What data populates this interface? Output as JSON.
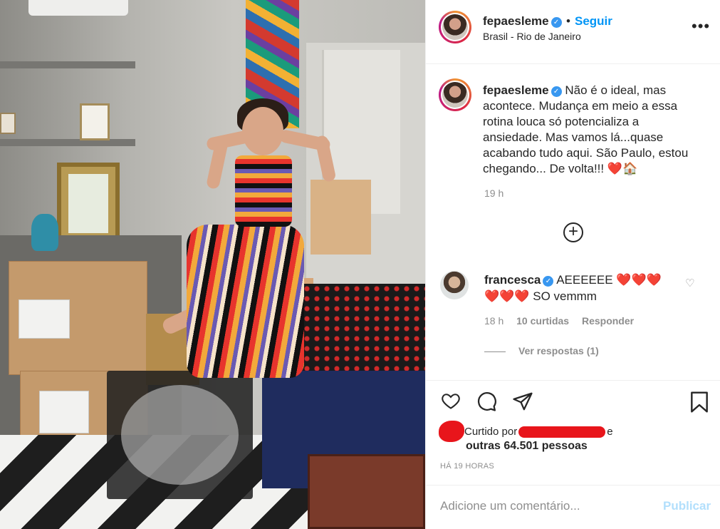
{
  "header": {
    "username": "fepaesleme",
    "separator": "•",
    "follow_label": "Seguir",
    "location": "Brasil - Rio de Janeiro",
    "more_icon": "more-horizontal-icon"
  },
  "caption": {
    "username": "fepaesleme",
    "text": "Não é o ideal, mas acontece. Mudança em meio a essa rotina louca só potencializa a ansiedade. Mas vamos lá...quase acabando tudo aqui. São Paulo, estou chegando... De volta!!!",
    "emoji_heart": "❤️",
    "emoji_house": "🏠",
    "time": "19 h"
  },
  "comments": [
    {
      "username": "francesca",
      "text": "AEEEEEE ❤️❤️❤️ ❤️❤️❤️ SO vemmm",
      "time": "18 h",
      "likes": "10 curtidas",
      "reply_label": "Responder"
    }
  ],
  "view_replies": "Ver respostas (1)",
  "likes": {
    "prefix": "Curtido por",
    "suffix": "e",
    "others": "outras 64.501 pessoas"
  },
  "timeago": "HÁ 19 HORAS",
  "add_comment": {
    "placeholder": "Adicione um comentário...",
    "publish_label": "Publicar"
  },
  "colors": {
    "accent": "#0095f6",
    "publish_disabled": "#b2dffc",
    "verified": "#3897f0",
    "muted": "#8e8e8e",
    "redaction": "#e8151b"
  }
}
